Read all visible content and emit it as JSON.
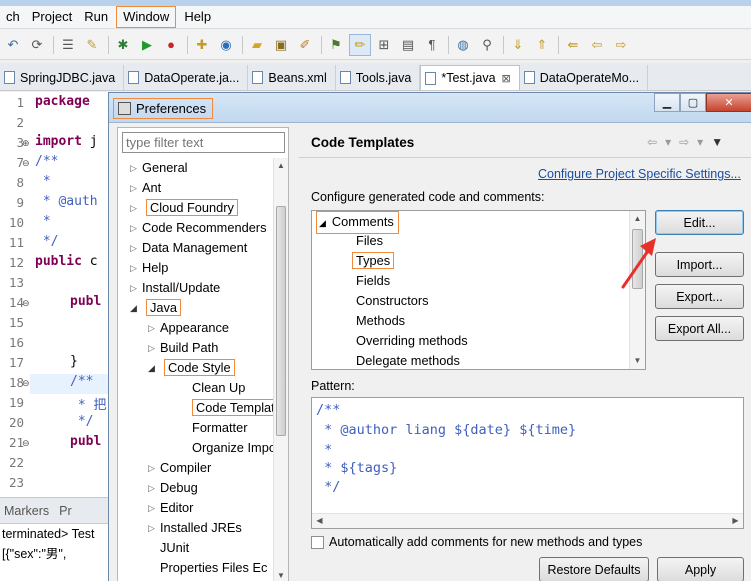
{
  "menu": [
    "ch",
    "Project",
    "Run",
    "Window",
    "Help"
  ],
  "editor_tabs": [
    {
      "label": "SpringJDBC.java"
    },
    {
      "label": "DataOperate.ja..."
    },
    {
      "label": "Beans.xml"
    },
    {
      "label": "Tools.java"
    },
    {
      "label": "*Test.java",
      "close": "⊠"
    },
    {
      "label": "DataOperateMo..."
    }
  ],
  "editor": {
    "line_numbers": [
      "1",
      "2",
      "3",
      "7",
      "8",
      "9",
      "10",
      "11",
      "12",
      "13",
      "14",
      "15",
      "16",
      "17",
      "18",
      "19",
      "20",
      "21",
      "22",
      "23"
    ],
    "code": {
      "l1_kw": "package",
      "l3_kw": "import",
      "l3_rest": " j",
      "l7": "/**",
      "l8": " *",
      "l9": " * @auth",
      "l10": " *",
      "l11": " */",
      "l12_kw": "public",
      "l12_rest": " c",
      "l14_kw": "publ",
      "l17": "}",
      "l18": "/**",
      "l19": " * 把",
      "l20": " */",
      "l21_kw": "publ"
    }
  },
  "bottom_panel": {
    "tabs": [
      "Markers",
      "Pr"
    ],
    "lines": [
      "terminated> Test",
      "[{\"sex\":\"男\","
    ]
  },
  "dialog": {
    "title": "Preferences",
    "filter_placeholder": "type filter text",
    "tree": {
      "general": "General",
      "ant": "Ant",
      "cloud_foundry": "Cloud Foundry",
      "code_recommenders": "Code Recommenders",
      "data_management": "Data Management",
      "help": "Help",
      "install_update": "Install/Update",
      "java": "Java",
      "appearance": "Appearance",
      "build_path": "Build Path",
      "code_style": "Code Style",
      "clean_up": "Clean Up",
      "code_templates": "Code Template",
      "formatter": "Formatter",
      "organize_imports": "Organize Impo",
      "compiler": "Compiler",
      "debug": "Debug",
      "editor": "Editor",
      "installed_jres": "Installed JREs",
      "junit": "JUnit",
      "properties_files": "Properties Files Ec"
    },
    "page_title": "Code Templates",
    "configure_link": "Configure Project Specific Settings...",
    "configure_label": "Configure generated code and comments:",
    "template_list": {
      "comments": "Comments",
      "items": [
        "Files",
        "Types",
        "Fields",
        "Constructors",
        "Methods",
        "Overriding methods",
        "Delegate methods"
      ]
    },
    "buttons": {
      "edit": "Edit...",
      "import": "Import...",
      "export": "Export...",
      "export_all": "Export All...",
      "restore_defaults": "Restore Defaults",
      "apply": "Apply"
    },
    "pattern_label": "Pattern:",
    "pattern_lines": [
      "/**",
      " * @author liang ${date} ${time}",
      " *",
      " * ${tags}",
      " */"
    ],
    "auto_comment_label": "Automatically add comments for new methods and types",
    "annotation_color": "#e8302a",
    "highlight_color": "#f08a3c"
  }
}
